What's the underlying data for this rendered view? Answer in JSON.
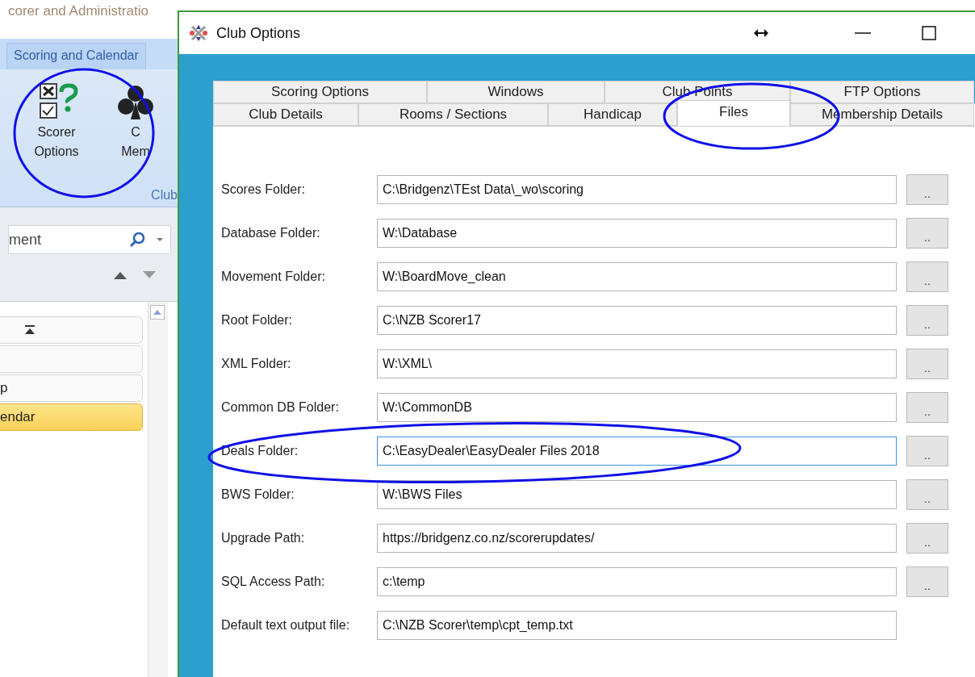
{
  "background_app": {
    "title": "corer and Administratio",
    "ribbon_tab": "Scoring and Calendar",
    "ribbon_buttons": [
      {
        "kind": "options",
        "line1": "Scorer",
        "line2": "Options"
      },
      {
        "kind": "club",
        "line1": "C",
        "line2": "Mem"
      }
    ],
    "group_label": "Club",
    "search": {
      "value": "ment"
    },
    "list_items": [
      {
        "kind": "jump",
        "selected": false
      },
      {
        "kind": "text",
        "selected": false
      },
      {
        "kind": "text",
        "label": "p",
        "selected": false
      },
      {
        "kind": "text",
        "label": "endar",
        "selected": true
      }
    ]
  },
  "window": {
    "title": "Club Options"
  },
  "tab_rows": [
    [
      {
        "label": "Scoring Options",
        "selected": false
      },
      {
        "label": "Windows",
        "selected": false
      },
      {
        "label": "Club Points",
        "selected": false
      },
      {
        "label": "FTP Options",
        "selected": false
      }
    ],
    [
      {
        "label": "Club Details",
        "selected": false
      },
      {
        "label": "Rooms / Sections",
        "selected": false
      },
      {
        "label": "Handicap",
        "selected": false
      },
      {
        "label": "Files",
        "selected": true
      },
      {
        "label": "Membership Details",
        "selected": false
      }
    ]
  ],
  "fields": [
    {
      "label": "Scores Folder:",
      "value": "C:\\Bridgenz\\TEst Data\\_wo\\scoring",
      "focused": false,
      "browse": ".."
    },
    {
      "label": "Database Folder:",
      "value": "W:\\Database",
      "focused": false,
      "browse": ".."
    },
    {
      "label": "Movement Folder:",
      "value": "W:\\BoardMove_clean",
      "focused": false,
      "browse": ".."
    },
    {
      "label": "Root Folder:",
      "value": "C:\\NZB Scorer17",
      "focused": false,
      "browse": ".."
    },
    {
      "label": "XML Folder:",
      "value": "W:\\XML\\",
      "focused": false,
      "browse": ".."
    },
    {
      "label": "Common DB Folder:",
      "value": "W:\\CommonDB",
      "focused": false,
      "browse": ".."
    },
    {
      "label": "Deals Folder:",
      "value": "C:\\EasyDealer\\EasyDealer Files 2018",
      "focused": true,
      "browse": ".."
    },
    {
      "label": "BWS Folder:",
      "value": "W:\\BWS Files",
      "focused": false,
      "browse": ".."
    },
    {
      "label": "Upgrade Path:",
      "value": "https://bridgenz.co.nz/scorerupdates/",
      "focused": false,
      "browse": ".."
    },
    {
      "label": "SQL Access Path:",
      "value": "c:\\temp",
      "focused": false,
      "browse": ".."
    },
    {
      "label": "Default text output file:",
      "value": "C:\\NZB Scorer\\temp\\cpt_temp.txt",
      "focused": false
    }
  ]
}
